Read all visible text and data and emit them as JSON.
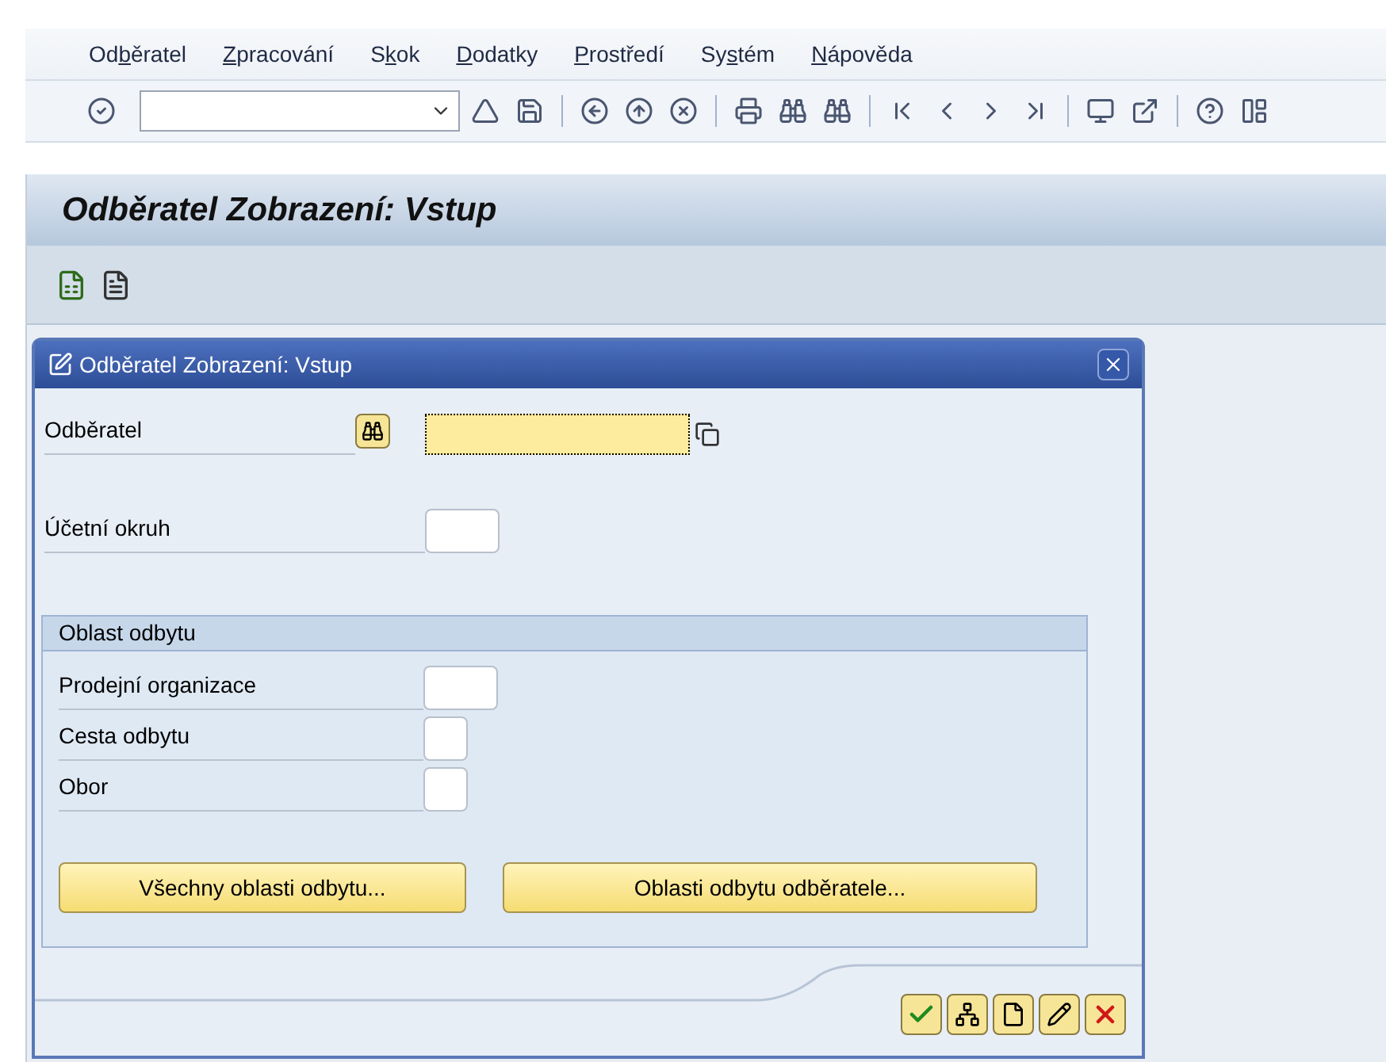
{
  "menu": [
    {
      "before": "Od",
      "key": "b",
      "after": "ěratel"
    },
    {
      "key": "Z",
      "after": "pracování"
    },
    {
      "before": "S",
      "key": "k",
      "after": "ok"
    },
    {
      "key": "D",
      "after": "odatky"
    },
    {
      "key": "P",
      "after": "rostředí"
    },
    {
      "before": "Sy",
      "key": "s",
      "after": "tém"
    },
    {
      "key": "N",
      "after": "ápověda"
    }
  ],
  "screen_title": "Odběratel Zobrazení: Vstup",
  "dialog": {
    "title": "Odběratel Zobrazení: Vstup",
    "fields": [
      {
        "label": "Odběratel",
        "focused": true,
        "search_help": true
      },
      {
        "label": "Účetní okruh",
        "focused": false,
        "search_help": false
      }
    ],
    "group": {
      "title": "Oblast odbytu",
      "fields": [
        {
          "label": "Prodejní organizace",
          "focused": false
        },
        {
          "label": "Cesta odbytu",
          "focused": false
        },
        {
          "label": "Obor",
          "focused": false
        }
      ],
      "buttons": [
        "Všechny oblasti odbytu...",
        "Oblasti odbytu odběratele..."
      ]
    }
  }
}
